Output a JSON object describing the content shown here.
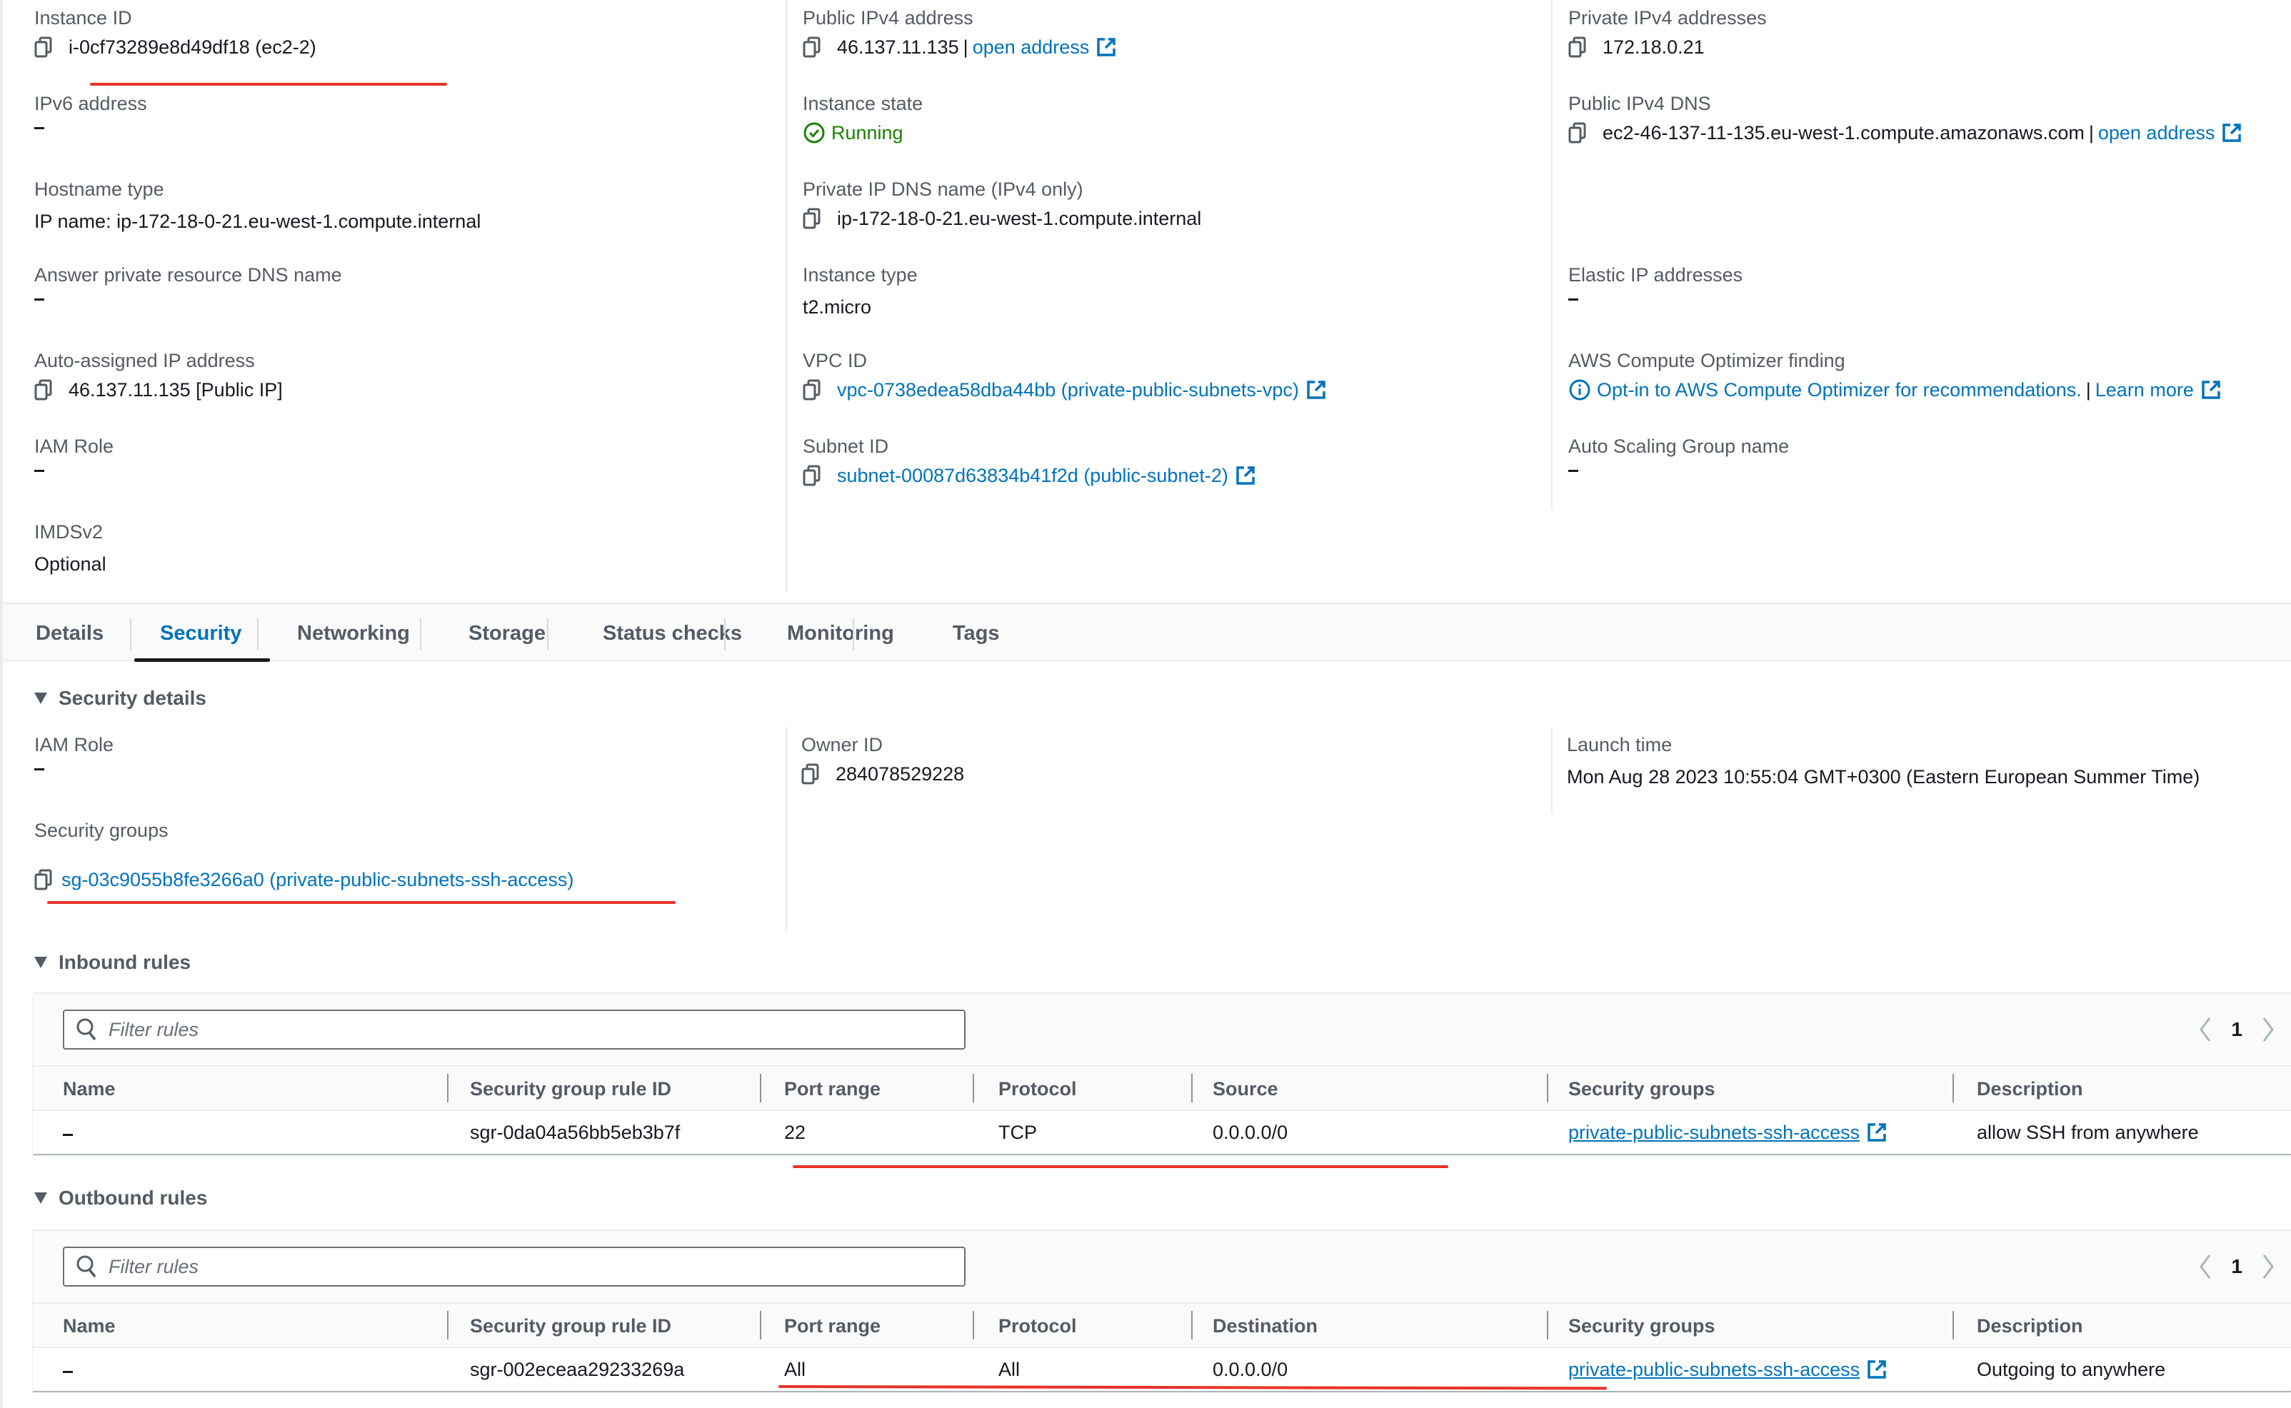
{
  "summary": {
    "col1": [
      {
        "label": "Instance ID",
        "value": "i-0cf73289e8d49df18 (ec2-2)"
      },
      {
        "label": "IPv6 address",
        "value": "–"
      },
      {
        "label": "Hostname type",
        "value": "IP name: ip-172-18-0-21.eu-west-1.compute.internal"
      },
      {
        "label": "Answer private resource DNS name",
        "value": "–"
      },
      {
        "label": "Auto-assigned IP address",
        "value": "46.137.11.135 [Public IP]"
      },
      {
        "label": "IAM Role",
        "value": "–"
      },
      {
        "label": "IMDSv2",
        "value": "Optional"
      }
    ],
    "col2": [
      {
        "label": "Public IPv4 address",
        "value": "46.137.11.135",
        "separator": "|",
        "link": "open address"
      },
      {
        "label": "Instance state",
        "value": "Running"
      },
      {
        "label": "Private IP DNS name (IPv4 only)",
        "value": "ip-172-18-0-21.eu-west-1.compute.internal"
      },
      {
        "label": "Instance type",
        "value": "t2.micro"
      },
      {
        "label": "VPC ID",
        "link": "vpc-0738edea58dba44bb (private-public-subnets-vpc)"
      },
      {
        "label": "Subnet ID",
        "link": "subnet-00087d63834b41f2d (public-subnet-2)"
      }
    ],
    "col3": [
      {
        "label": "Private IPv4 addresses",
        "value": "172.18.0.21"
      },
      {
        "label": "Public IPv4 DNS",
        "value": "ec2-46-137-11-135.eu-west-1.compute.amazonaws.com",
        "separator": "|",
        "link": "open address"
      },
      {
        "label": "Elastic IP addresses",
        "value": "–"
      },
      {
        "label": "AWS Compute Optimizer finding",
        "link": "Opt-in to AWS Compute Optimizer for recommendations.",
        "separator": "|",
        "link2": "Learn more"
      },
      {
        "label": "Auto Scaling Group name",
        "value": "–"
      }
    ]
  },
  "tabs": [
    {
      "label": "Details",
      "active": false
    },
    {
      "label": "Security",
      "active": true
    },
    {
      "label": "Networking",
      "active": false
    },
    {
      "label": "Storage",
      "active": false
    },
    {
      "label": "Status checks",
      "active": false
    },
    {
      "label": "Monitoring",
      "active": false
    },
    {
      "label": "Tags",
      "active": false
    }
  ],
  "security_details": {
    "title": "Security details",
    "iam_role_label": "IAM Role",
    "iam_role_value": "–",
    "security_groups_label": "Security groups",
    "security_group_link": "sg-03c9055b8fe3266a0 (private-public-subnets-ssh-access)",
    "owner_id_label": "Owner ID",
    "owner_id_value": "284078529228",
    "launch_time_label": "Launch time",
    "launch_time_value": "Mon Aug 28 2023 10:55:04 GMT+0300 (Eastern European Summer Time)"
  },
  "inbound": {
    "title": "Inbound rules",
    "filter_placeholder": "Filter rules",
    "filter_value": "",
    "page": "1",
    "columns": [
      "Name",
      "Security group rule ID",
      "Port range",
      "Protocol",
      "Source",
      "Security groups",
      "Description"
    ],
    "rows": [
      {
        "name": "–",
        "rule_id": "sgr-0da04a56bb5eb3b7f",
        "port_range": "22",
        "protocol": "TCP",
        "source": "0.0.0.0/0",
        "security_group": "private-public-subnets-ssh-access",
        "description": "allow SSH from anywhere"
      }
    ]
  },
  "outbound": {
    "title": "Outbound rules",
    "filter_placeholder": "Filter rules",
    "filter_value": "",
    "page": "1",
    "columns": [
      "Name",
      "Security group rule ID",
      "Port range",
      "Protocol",
      "Destination",
      "Security groups",
      "Description"
    ],
    "rows": [
      {
        "name": "–",
        "rule_id": "sgr-002eceaa29233269a",
        "port_range": "All",
        "protocol": "All",
        "destination": "0.0.0.0/0",
        "security_group": "private-public-subnets-ssh-access",
        "description": "Outgoing to anywhere"
      }
    ]
  },
  "colors": {
    "link": "#0073bb",
    "running": "#1d8102",
    "annotation_red": "#e8322a",
    "label_gray": "#545b64"
  }
}
